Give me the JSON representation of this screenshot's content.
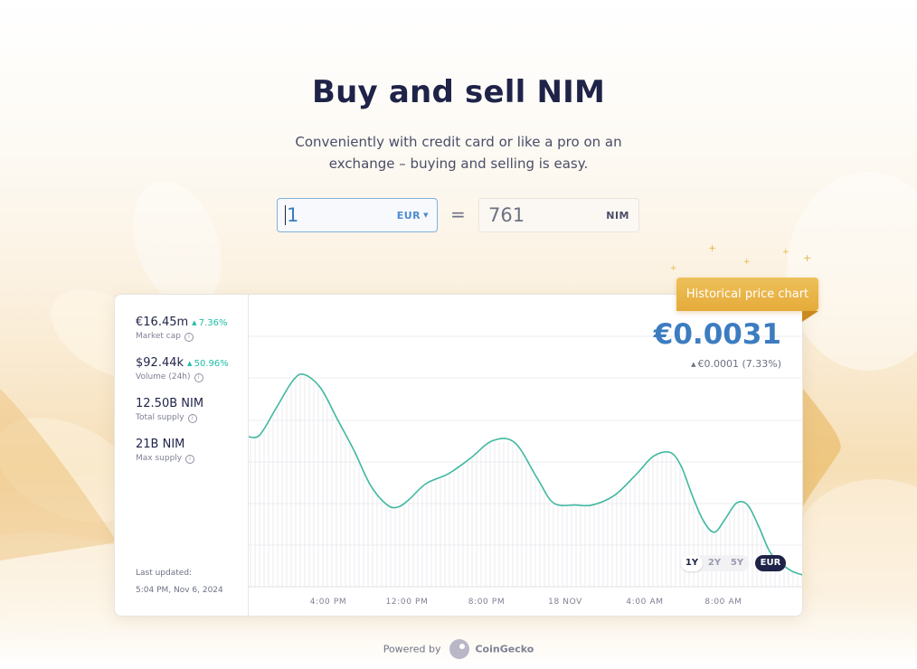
{
  "header": {
    "title": "Buy and sell NIM",
    "subtitle": "Conveniently with credit card or like a pro on an exchange – buying and selling is easy."
  },
  "converter": {
    "from_value": "1",
    "from_currency": "EUR",
    "equals": "=",
    "to_value": "761",
    "to_currency": "NIM"
  },
  "badge": {
    "label": "Historical price chart"
  },
  "stats": [
    {
      "value": "€16.45m",
      "change": "7.36%",
      "label": "Market cap"
    },
    {
      "value": "$92.44k",
      "change": "50.96%",
      "label": "Volume (24h)"
    },
    {
      "value": "12.50B NIM",
      "change": "",
      "label": "Total supply"
    },
    {
      "value": "21B NIM",
      "change": "",
      "label": "Max supply"
    }
  ],
  "last_updated": {
    "label": "Last updated:",
    "time": "5:04 PM, Nov 6, 2024"
  },
  "price": {
    "current": "€0.0031",
    "change": "€0.0001 (7.33%)"
  },
  "range": {
    "options": [
      "1Y",
      "2Y",
      "5Y"
    ],
    "selected": "1Y",
    "currency": "EUR"
  },
  "footer": {
    "powered_by": "Powered by",
    "provider": "CoinGecko"
  },
  "colors": {
    "accent": "#3c7cc0",
    "line": "#41b8a0",
    "positive": "#21bca5",
    "badge": "#e8b445",
    "navy": "#1f2348"
  },
  "chart_data": {
    "type": "line",
    "title": "",
    "xlabel": "",
    "ylabel": "",
    "x_ticks": [
      "4:00 PM",
      "12:00 PM",
      "8:00 PM",
      "18 NOV",
      "4:00 AM",
      "8:00 AM"
    ],
    "x": [
      0,
      0.02,
      0.05,
      0.08,
      0.1,
      0.13,
      0.16,
      0.19,
      0.22,
      0.25,
      0.27,
      0.29,
      0.32,
      0.36,
      0.4,
      0.44,
      0.48,
      0.52,
      0.55,
      0.59,
      0.62,
      0.66,
      0.7,
      0.73,
      0.76,
      0.78,
      0.8,
      0.82,
      0.84,
      0.86,
      0.88,
      0.9,
      0.92,
      0.94,
      0.96,
      0.98,
      1.0
    ],
    "y": [
      0.00297,
      0.00298,
      0.00312,
      0.00326,
      0.00329,
      0.00322,
      0.00306,
      0.0029,
      0.00272,
      0.00262,
      0.00261,
      0.00265,
      0.00273,
      0.00278,
      0.00286,
      0.00295,
      0.00294,
      0.00276,
      0.00263,
      0.00262,
      0.00262,
      0.00267,
      0.00278,
      0.00287,
      0.00289,
      0.00282,
      0.00267,
      0.00254,
      0.00248,
      0.00255,
      0.00263,
      0.00262,
      0.00251,
      0.00238,
      0.00232,
      0.00228,
      0.00226
    ],
    "ylim": [
      0.0022,
      0.0037
    ],
    "grid": true,
    "legend": "none"
  }
}
